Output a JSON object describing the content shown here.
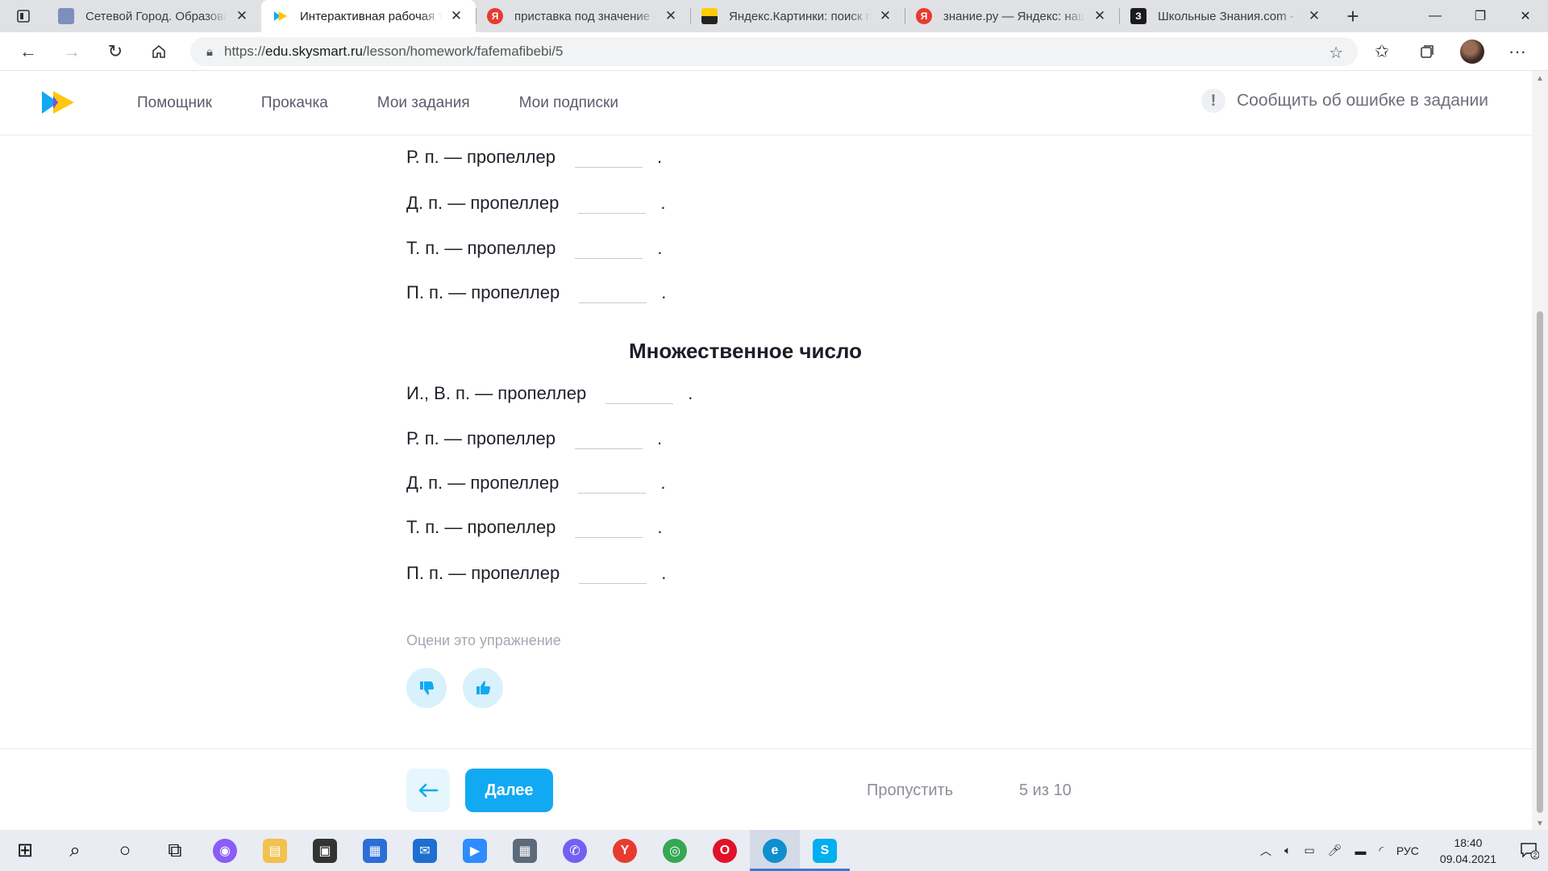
{
  "browser": {
    "tabs": [
      {
        "title": "Сетевой Город. Образование",
        "favicon": "school-portal-icon",
        "color": "#7d8fbf",
        "active": false
      },
      {
        "title": "Интерактивная рабочая тетрадь Skysmart",
        "favicon": "skysmart-icon",
        "color": "#11a9f2",
        "active": true
      },
      {
        "title": "приставка под значение — Яндекс",
        "favicon": "yandex-icon",
        "color": "#e83b2f",
        "active": false
      },
      {
        "title": "Яндекс.Картинки: поиск по картинкам",
        "favicon": "yandex-images-icon",
        "color": "#f5c400",
        "active": false
      },
      {
        "title": "знание.ру — Яндекс: нашлось",
        "favicon": "yandex-icon",
        "color": "#e83b2f",
        "active": false
      },
      {
        "title": "Школьные Знания.com - Р",
        "favicon": "znania-icon",
        "color": "#1b1b1b",
        "active": false
      }
    ],
    "url_scheme": "https://",
    "url_host": "edu.skysmart.ru",
    "url_path": "/lesson/homework/fafemafibebi/5"
  },
  "header": {
    "nav": [
      "Помощник",
      "Прокачка",
      "Мои задания",
      "Мои подписки"
    ],
    "report_label": "Сообщить об ошибке в задании",
    "report_icon": "!"
  },
  "exercise": {
    "singular_rows": [
      {
        "case": "Р. п. — пропеллер",
        "blank_width": 84
      },
      {
        "case": "Д. п. — пропеллер",
        "blank_width": 84
      },
      {
        "case": "Т. п. — пропеллер",
        "blank_width": 84
      },
      {
        "case": "П. п. — пропеллер",
        "blank_width": 84
      }
    ],
    "plural_title": "Множественное число",
    "plural_rows": [
      {
        "case": "И., В. п. — пропеллер",
        "blank_width": 84
      },
      {
        "case": "Р. п. — пропеллер",
        "blank_width": 84
      },
      {
        "case": "Д. п. — пропеллер",
        "blank_width": 84
      },
      {
        "case": "Т. п. — пропеллер",
        "blank_width": 84
      },
      {
        "case": "П. п. — пропеллер",
        "blank_width": 84
      }
    ],
    "row_suffix": ".",
    "rate_label": "Оцени это упражнение"
  },
  "footer": {
    "next_label": "Далее",
    "skip_label": "Пропустить",
    "progress": "5 из 10",
    "progress_current": 5,
    "progress_total": 10
  },
  "taskbar": {
    "apps": [
      {
        "name": "start-icon"
      },
      {
        "name": "search-icon"
      },
      {
        "name": "cortana-icon"
      },
      {
        "name": "task-view-icon"
      },
      {
        "name": "alice-icon",
        "color": "#8b5cf6"
      },
      {
        "name": "file-explorer-icon",
        "color": "#f2c14e"
      },
      {
        "name": "store-icon",
        "color": "#333333"
      },
      {
        "name": "news-icon",
        "color": "#2b6fd6"
      },
      {
        "name": "mail-icon",
        "color": "#1f6fd0"
      },
      {
        "name": "zoom-icon",
        "color": "#2d8cff"
      },
      {
        "name": "calculator-icon",
        "color": "#5c6b7a"
      },
      {
        "name": "viber-icon",
        "color": "#7360f2"
      },
      {
        "name": "yandex-browser-icon",
        "color": "#e83b2f"
      },
      {
        "name": "chrome-icon",
        "color": "#34a853"
      },
      {
        "name": "opera-icon",
        "color": "#e0122a"
      },
      {
        "name": "edge-icon",
        "color": "#0f8fcf"
      },
      {
        "name": "skype-icon",
        "color": "#00aff0"
      }
    ],
    "lang": "РУС",
    "time": "18:40",
    "date": "09.04.2021",
    "notifications": "2"
  },
  "colors": {
    "accent": "#11a9f2",
    "accent_light": "#d9f1fb"
  }
}
